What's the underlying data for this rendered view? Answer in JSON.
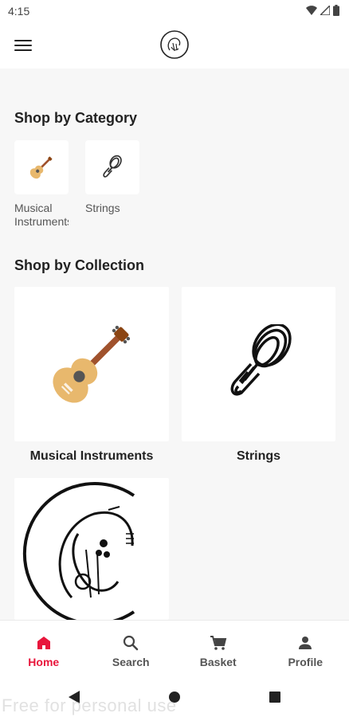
{
  "status_bar": {
    "time": "4:15",
    "icons": [
      "wifi-icon",
      "signal-icon",
      "battery-icon"
    ]
  },
  "app_bar": {
    "menu_icon": "hamburger-menu-icon",
    "logo": "brand-logo"
  },
  "category_section": {
    "title": "Shop by Category",
    "items": [
      {
        "label": "Musical Instruments",
        "icon": "guitar-icon"
      },
      {
        "label": "Strings",
        "icon": "rope-icon"
      }
    ]
  },
  "collection_section": {
    "title": "Shop by Collection",
    "items": [
      {
        "label": "Musical Instruments",
        "icon": "guitar-icon"
      },
      {
        "label": "Strings",
        "icon": "rope-icon"
      },
      {
        "label": "",
        "icon": "brand-logo"
      }
    ]
  },
  "bottom_nav": {
    "items": [
      {
        "label": "Home",
        "icon": "home-icon",
        "active": true
      },
      {
        "label": "Search",
        "icon": "search-icon",
        "active": false
      },
      {
        "label": "Basket",
        "icon": "cart-icon",
        "active": false
      },
      {
        "label": "Profile",
        "icon": "person-icon",
        "active": false
      }
    ]
  },
  "colors": {
    "accent": "#e8163c",
    "background": "#f7f7f7",
    "guitar_body": "#e8b86d"
  },
  "watermark": "Free for personal use"
}
